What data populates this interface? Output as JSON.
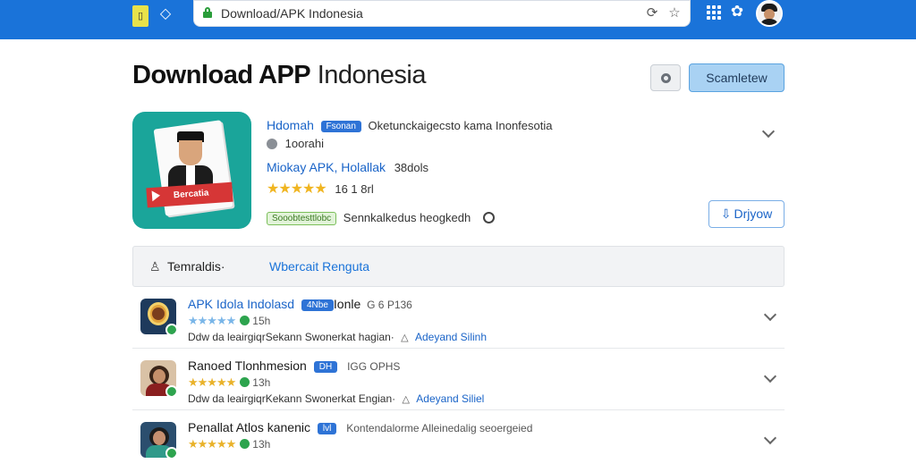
{
  "browser": {
    "url": "Download/APK Indonesia"
  },
  "header": {
    "title_bold": "Download APP",
    "title_light": "Indonesia",
    "search_button": "Scamletew"
  },
  "featured": {
    "banner_text": "Bercatia",
    "title": "Hdomah",
    "badge": "Fsonan",
    "tagline": "Oketunckaigecsto kama Inonfesotia",
    "sub_line": "1oorahi",
    "subtitle": "Miokay APK, Holallak",
    "subtitle_meta": "38dols",
    "rating_text": "16 1 8rl",
    "status_badge": "Sooobtesttlobc",
    "status_text": "Sennkalkedus heogkedh",
    "download_label": "Drjyow"
  },
  "tabs": {
    "label": "Temraldis·",
    "link": "Wbercait Renguta"
  },
  "list": [
    {
      "title": "APK Idola Indolasd",
      "title_color": "blue",
      "badge": "4Nbe",
      "badge_tail": "Ionle",
      "meta": "G 6 P136",
      "stars_style": "blue",
      "stars": "★★★★★",
      "count": "15h",
      "desc": "Ddw da leairgiqrSekann Swonerkat hagian·",
      "developer": "Adeyand Silinh",
      "icon_color": "#1e3a5c"
    },
    {
      "title": "Ranoed Tlonhmesion",
      "title_color": "dark",
      "badge": "DH",
      "badge_tail": "",
      "meta": "IGG OPHS",
      "stars_style": "gold",
      "stars": "★★★★★",
      "count": "13h",
      "desc": "Ddw da leairgiqrKekann Swonerkat Engian·",
      "developer": "Adeyand Siliel",
      "icon_color": "#7b3b2a"
    },
    {
      "title": "Penallat Atlos kanenic",
      "title_color": "dark",
      "badge": "lvl",
      "badge_tail": "",
      "meta": "Kontendalorme Alleinedalig seoergeied",
      "stars_style": "gold",
      "stars": "★★★★★",
      "count": "13h",
      "desc": "",
      "developer": "",
      "icon_color": "#2b4e6e"
    }
  ]
}
